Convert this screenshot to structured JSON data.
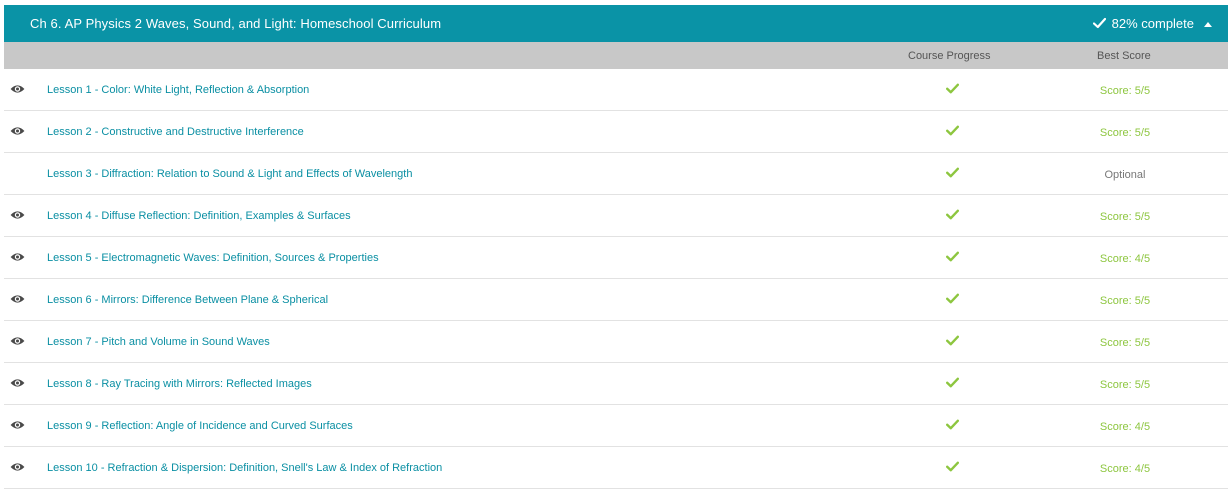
{
  "chapter": {
    "title": "Ch 6. AP Physics 2 Waves, Sound, and Light: Homeschool Curriculum",
    "complete_text": "82% complete",
    "check_icon": "check-icon",
    "collapse_icon": "caret-up-icon"
  },
  "columns": {
    "course_progress": "Course Progress",
    "best_score": "Best Score"
  },
  "colors": {
    "header_bg": "#0a93a6",
    "column_bar_bg": "#c8c8c8",
    "link": "#0a8fa3",
    "check_green": "#8dc63f",
    "optional_gray": "#777777"
  },
  "lessons": [
    {
      "title": "Lesson 1 - Color: White Light, Reflection & Absorption",
      "viewed": true,
      "completed": true,
      "score": "Score: 5/5",
      "optional": false
    },
    {
      "title": "Lesson 2 - Constructive and Destructive Interference",
      "viewed": true,
      "completed": true,
      "score": "Score: 5/5",
      "optional": false
    },
    {
      "title": "Lesson 3 - Diffraction: Relation to Sound & Light and Effects of Wavelength",
      "viewed": false,
      "completed": true,
      "score": "Optional",
      "optional": true
    },
    {
      "title": "Lesson 4 - Diffuse Reflection: Definition, Examples & Surfaces",
      "viewed": true,
      "completed": true,
      "score": "Score: 5/5",
      "optional": false
    },
    {
      "title": "Lesson 5 - Electromagnetic Waves: Definition, Sources & Properties",
      "viewed": true,
      "completed": true,
      "score": "Score: 4/5",
      "optional": false
    },
    {
      "title": "Lesson 6 - Mirrors: Difference Between Plane & Spherical",
      "viewed": true,
      "completed": true,
      "score": "Score: 5/5",
      "optional": false
    },
    {
      "title": "Lesson 7 - Pitch and Volume in Sound Waves",
      "viewed": true,
      "completed": true,
      "score": "Score: 5/5",
      "optional": false
    },
    {
      "title": "Lesson 8 - Ray Tracing with Mirrors: Reflected Images",
      "viewed": true,
      "completed": true,
      "score": "Score: 5/5",
      "optional": false
    },
    {
      "title": "Lesson 9 - Reflection: Angle of Incidence and Curved Surfaces",
      "viewed": true,
      "completed": true,
      "score": "Score: 4/5",
      "optional": false
    },
    {
      "title": "Lesson 10 - Refraction & Dispersion: Definition, Snell's Law & Index of Refraction",
      "viewed": true,
      "completed": true,
      "score": "Score: 4/5",
      "optional": false
    }
  ]
}
